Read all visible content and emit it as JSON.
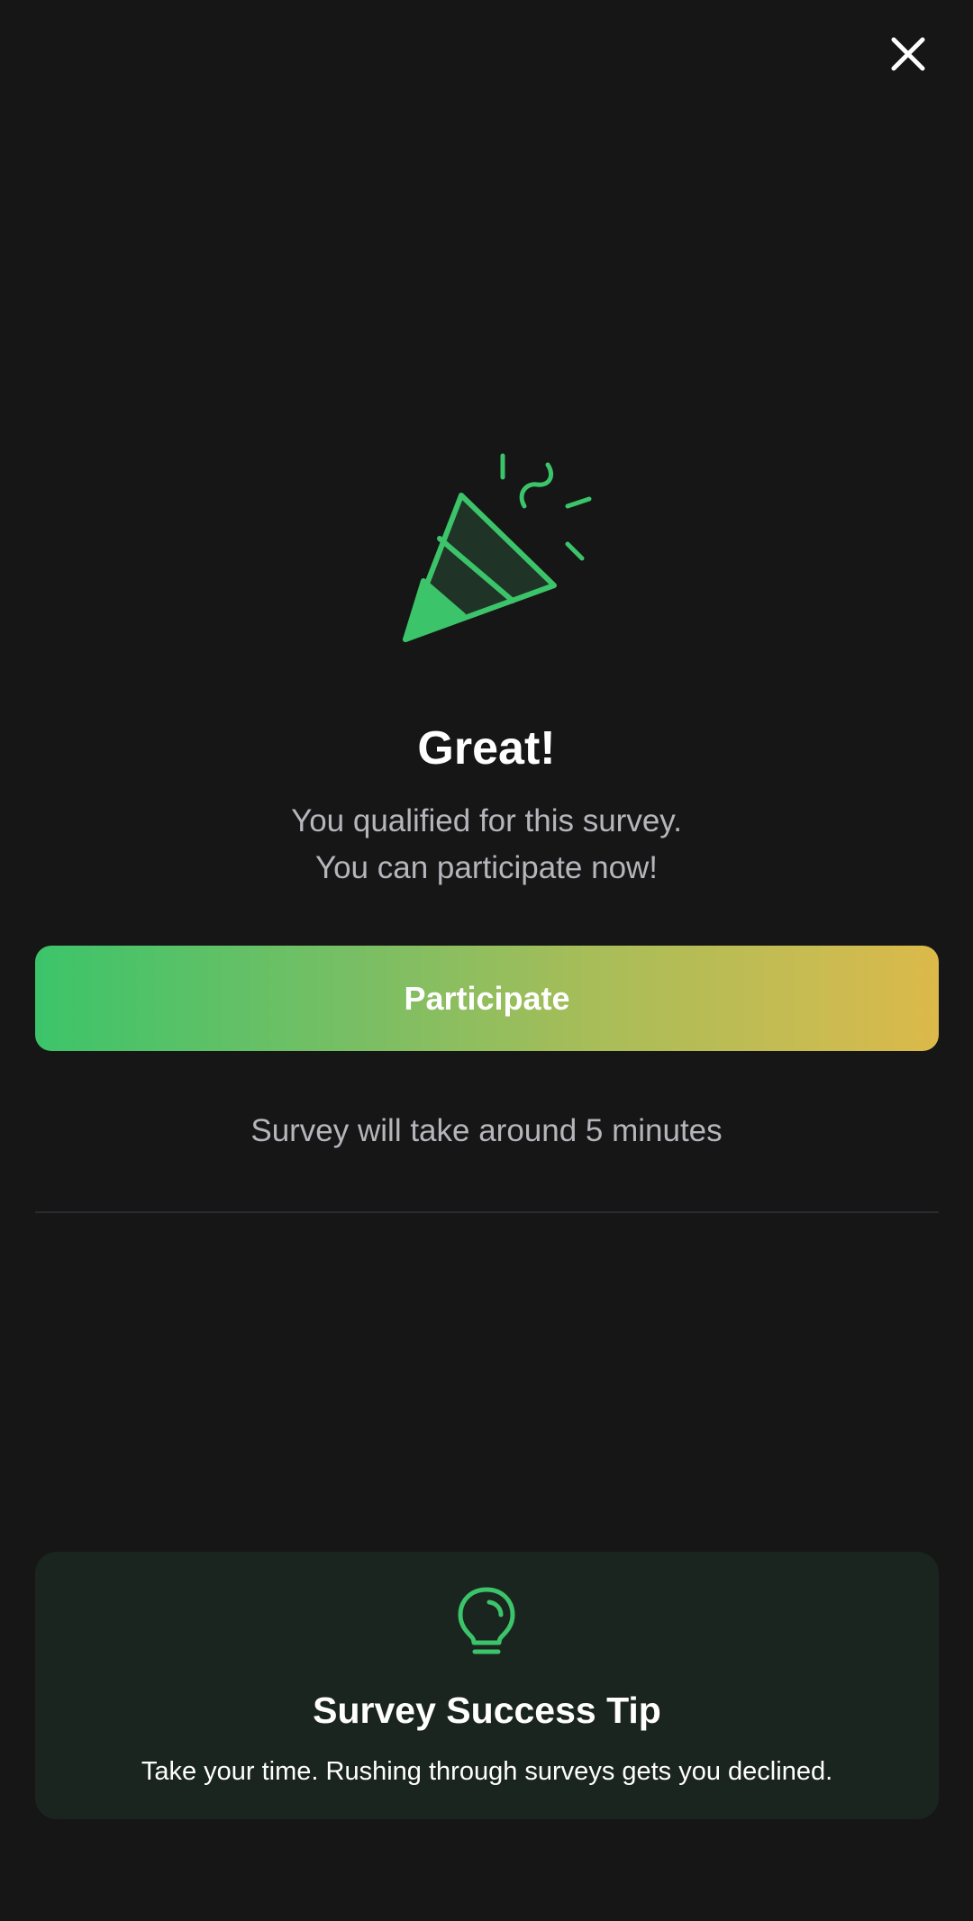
{
  "header": {
    "close_icon": "close-icon"
  },
  "hero": {
    "icon": "party-popper-icon",
    "title": "Great!",
    "subtitle_line1": "You qualified for this survey.",
    "subtitle_line2": "You can participate now!"
  },
  "action": {
    "participate_label": "Participate",
    "duration_text": "Survey will take around 5 minutes"
  },
  "tip": {
    "icon": "lightbulb-icon",
    "title": "Survey Success Tip",
    "text": "Take your time. Rushing through surveys gets you declined."
  },
  "colors": {
    "background": "#161616",
    "accent_green": "#3cc46a",
    "gradient_end": "#dcb94a",
    "secondary_text": "#b5b5bb",
    "tip_card_bg": "#1b251f"
  }
}
